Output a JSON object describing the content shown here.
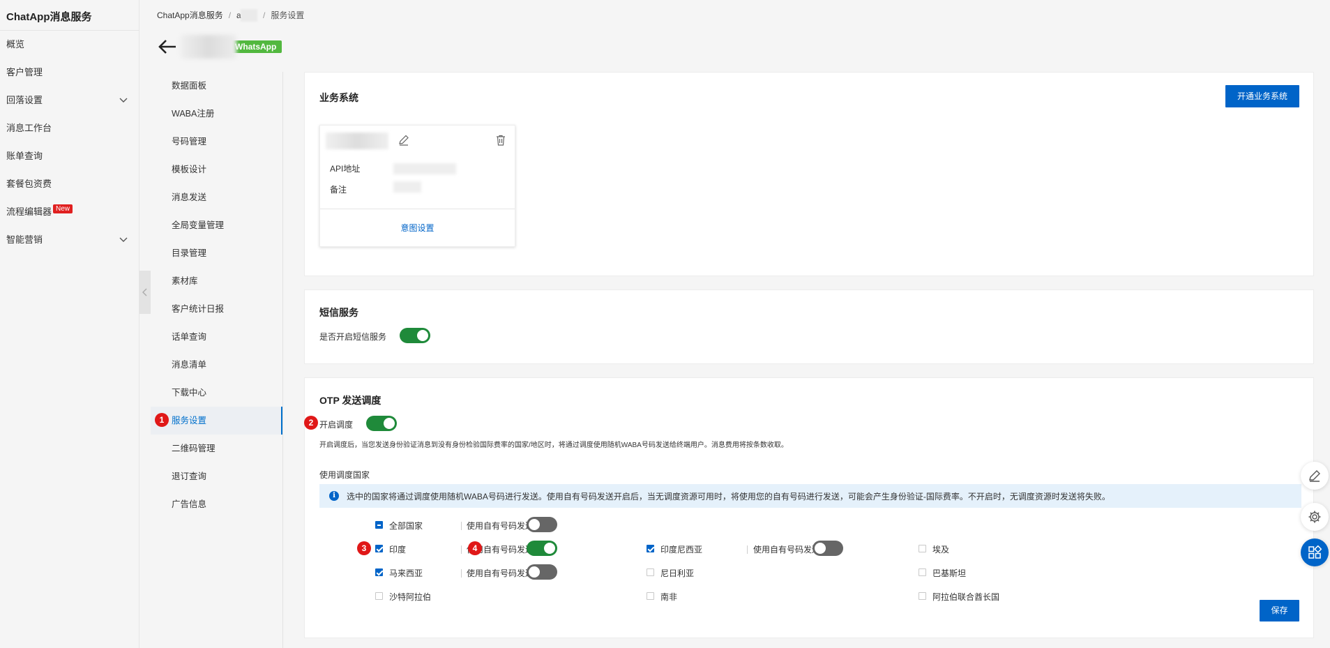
{
  "app": {
    "title": "ChatApp消息服务"
  },
  "global_nav": {
    "items": [
      {
        "label": "概览",
        "has_chevron": false
      },
      {
        "label": "客户管理",
        "has_chevron": false
      },
      {
        "label": "回落设置",
        "has_chevron": true
      },
      {
        "label": "消息工作台",
        "has_chevron": false
      },
      {
        "label": "账单查询",
        "has_chevron": false
      },
      {
        "label": "套餐包资费",
        "has_chevron": false
      },
      {
        "label": "流程编辑器",
        "has_chevron": false,
        "badge": "New"
      },
      {
        "label": "智能营销",
        "has_chevron": true
      }
    ]
  },
  "breadcrumb": {
    "root": "ChatApp消息服务",
    "middle": "a",
    "current": "服务设置"
  },
  "header": {
    "channel_tag": "WhatsApp"
  },
  "inner_menu": {
    "items": [
      "数据面板",
      "WABA注册",
      "号码管理",
      "模板设计",
      "消息发送",
      "全局变量管理",
      "目录管理",
      "素材库",
      "客户统计日报",
      "话单查询",
      "消息清单",
      "下载中心",
      "服务设置",
      "二维码管理",
      "退订查询",
      "广告信息"
    ],
    "active": "服务设置"
  },
  "markers": {
    "m1": "1",
    "m2": "2",
    "m3": "3",
    "m4": "4"
  },
  "business_system": {
    "title": "业务系统",
    "open_button": "开通业务系统",
    "api_label": "API地址",
    "note_label": "备注",
    "intent_link": "意图设置"
  },
  "sms_service": {
    "title": "短信服务",
    "toggle_label": "是否开启短信服务",
    "enabled": true
  },
  "otp": {
    "title": "OTP 发送调度",
    "enable_label": "开启调度",
    "enabled": true,
    "description": "开启调度后，当您发送身份验证消息到没有身份检验国际费率的国家/地区时，将通过调度使用随机WABA号码发送给终端用户。消息费用将按条数收取。",
    "countries_label": "使用调度国家",
    "info_text": "选中的国家将通过调度使用随机WABA号码进行发送。使用自有号码发送开启后，当无调度资源可用时，将使用您的自有号码进行发送，可能会产生身份验证-国际费率。不开启时，无调度资源时发送将失败。",
    "own_number_label": "使用自有号码发送",
    "all_countries": {
      "label": "全部国家",
      "state": "partial",
      "own_number": false
    },
    "countries": [
      {
        "name": "印度",
        "checked": true,
        "own_number": true
      },
      {
        "name": "马来西亚",
        "checked": true,
        "own_number": false
      },
      {
        "name": "沙特阿拉伯",
        "checked": false
      },
      {
        "name": "印度尼西亚",
        "checked": true,
        "own_number": false
      },
      {
        "name": "尼日利亚",
        "checked": false
      },
      {
        "name": "南非",
        "checked": false
      },
      {
        "name": "埃及",
        "checked": false
      },
      {
        "name": "巴基斯坦",
        "checked": false
      },
      {
        "name": "阿拉伯联合酋长国",
        "checked": false
      }
    ],
    "save_button": "保存"
  },
  "float_tools": [
    "edit-icon",
    "gear-icon",
    "apps-icon"
  ],
  "colors": {
    "primary": "#0064c8",
    "toggle_on": "#1f8a3a",
    "whatsapp_green": "#52b83f",
    "marker_red": "#e01818"
  }
}
